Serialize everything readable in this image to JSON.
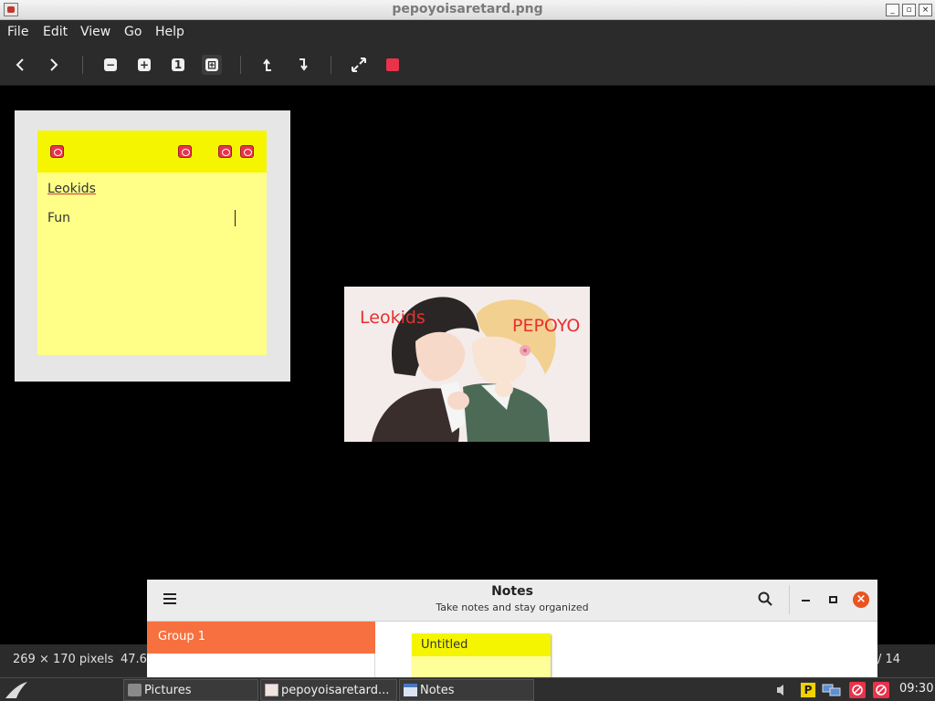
{
  "window": {
    "title": "pepoyoisaretard.png",
    "controls": [
      "_",
      "▫",
      "×"
    ]
  },
  "menu": [
    "File",
    "Edit",
    "View",
    "Go",
    "Help"
  ],
  "toolbar": {
    "icons": [
      "chevron-left-icon",
      "chevron-right-icon",
      "zoom-out-icon",
      "zoom-in-icon",
      "zoom-original-icon",
      "zoom-fit-icon",
      "rotate-left-icon",
      "rotate-right-icon",
      "fullscreen-icon",
      "stop-icon"
    ],
    "zoom_original_label": "1"
  },
  "sticky_note": {
    "title": "Leokids",
    "body": "Fun",
    "colors": {
      "header": "#f5f500",
      "body": "#ffff88",
      "icon": "#e8334a"
    }
  },
  "artwork": {
    "label_left": "Leokids",
    "label_right": "PEPOYO"
  },
  "status": {
    "dimensions": "269 × 170 pixels",
    "zoom": "47.6",
    "page": "/ 14"
  },
  "notes_app": {
    "title": "Notes",
    "subtitle": "Take notes and stay organized",
    "group": "Group 1",
    "note_title": "Untitled",
    "colors": {
      "accent": "#f7703f",
      "close": "#e95420"
    }
  },
  "taskbar": {
    "items": [
      "Pictures",
      "pepoyoisaretard...",
      "Notes"
    ],
    "clock": "09:30"
  }
}
